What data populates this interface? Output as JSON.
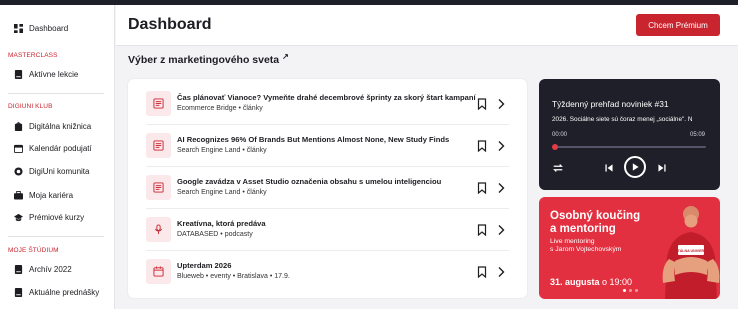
{
  "colors": {
    "accent": "#c9252f",
    "sidebar_bg": "#ffffff",
    "player_bg": "#1f1f29",
    "promo_bg": "#e23040"
  },
  "sidebar": {
    "dashboard": "Dashboard",
    "sections": [
      {
        "label": "MASTERCLASS",
        "items": [
          "Aktívne lekcie"
        ]
      },
      {
        "label": "DIGIUNI KLUB",
        "items": [
          "Digitálna knižnica",
          "Kalendár podujatí",
          "DigiUni komunita",
          "Moja kariéra",
          "Prémiové kurzy"
        ]
      },
      {
        "label": "MOJE ŠTÚDIUM",
        "items": [
          "Archív 2022",
          "Aktuálne prednášky"
        ]
      }
    ]
  },
  "header": {
    "title": "Dashboard",
    "premium_button": "Chcem Prémium"
  },
  "feed": {
    "title": "Výber z marketingového sveta",
    "title_icon": "external-link-icon",
    "items": [
      {
        "icon": "article-icon",
        "title": "Čas plánovať Vianoce? Vymeňte drahé decembrové šprinty za skorý štart kampaní",
        "meta": "Ecommerce Bridge • články"
      },
      {
        "icon": "article-icon",
        "title": "AI Recognizes 96% Of Brands But Mentions Almost None, New Study Finds",
        "meta": "Search Engine Land • články"
      },
      {
        "icon": "article-icon",
        "title": "Google zavádza v Asset Studio označenia obsahu s umelou inteligenciou",
        "meta": "Search Engine Land • články"
      },
      {
        "icon": "microphone-icon",
        "title": "Kreatívna, ktorá predáva",
        "meta": "DATABASED • podcasty"
      },
      {
        "icon": "calendar-icon",
        "title": "Upterdam 2026",
        "meta": "Blueweb • eventy  • Bratislava • 17.9."
      }
    ]
  },
  "player": {
    "title": "Týždenný prehľad noviniek #31",
    "description": "2026. Sociálne siete sú čoraz menej „sociálne\". N",
    "time_current": "00:00",
    "time_total": "05:09",
    "progress": 0
  },
  "promo": {
    "heading_line1": "Osobný koučing",
    "heading_line2": "a mentoring",
    "sub_line1": "Live mentoring",
    "sub_line2": "s Jarom Vojtechovským",
    "date_strong": "31. augusta",
    "date_rest": " o 19:00",
    "shirt_text": "DIGITÁLNA UNIVERZITA"
  }
}
